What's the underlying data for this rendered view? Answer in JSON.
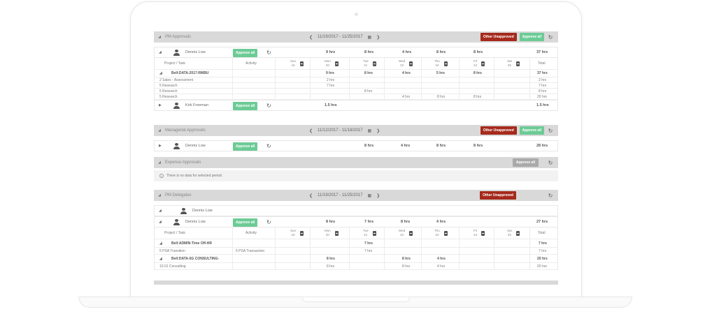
{
  "pm_approvals": {
    "title": "PM Approvals",
    "date_range": "11/19/2017 - 11/25/2017",
    "other_unapproved": "Other Unapproved",
    "approve_all": "Approve all",
    "person1": {
      "name": "Dennis Low",
      "approve_all": "Approve all",
      "hours": [
        "9 hrs",
        "8 hrs",
        "4 hrs",
        "8 hrs",
        "8 hrs"
      ],
      "total": "37 hrs"
    },
    "header": {
      "project_task": "Project / Task",
      "activity": "Activity",
      "days": [
        {
          "name": "Sun",
          "num": "19"
        },
        {
          "name": "Mon",
          "num": "20"
        },
        {
          "name": "Tue",
          "num": "21"
        },
        {
          "name": "Wed",
          "num": "22"
        },
        {
          "name": "Thu",
          "num": "23"
        },
        {
          "name": "Fri",
          "num": "24"
        },
        {
          "name": "Sat",
          "num": "25"
        }
      ],
      "total": "Total"
    },
    "project": {
      "name": "Bell:DATA-2017-RMBU",
      "hours": [
        "9 hrs",
        "8 hrs",
        "4 hrs",
        "5 hrs",
        "8 hrs"
      ],
      "total": "37 hrs"
    },
    "tasks": [
      {
        "name": "2 Sales - Assessment",
        "mon": "2 hrs",
        "tue": "",
        "wed": "",
        "thu": "",
        "fri": "",
        "total": "2 hrs"
      },
      {
        "name": "5 Research",
        "mon": "7 hrs",
        "tue": "",
        "wed": "",
        "thu": "",
        "fri": "",
        "total": "7 hrs"
      },
      {
        "name": "5 Research",
        "mon": "",
        "tue": "8 hrs",
        "wed": "",
        "thu": "",
        "fri": "",
        "total": "8 hrs"
      },
      {
        "name": "5 Research",
        "mon": "",
        "tue": "",
        "wed": "4 hrs",
        "thu": "8 hrs",
        "fri": "8 hrs",
        "total": "20 hrs"
      }
    ],
    "person2": {
      "name": "Kirk Freeman",
      "approve_all": "Approve all",
      "hours": "1.5 hrs",
      "total": "1.5 hrs"
    }
  },
  "managerial_approvals": {
    "title": "Managerial Approvals",
    "date_range": "11/12/2017 - 11/18/2017",
    "other_unapproved": "Other Unapproved",
    "approve_all": "Approve all",
    "person1": {
      "name": "Dennis Low",
      "approve_all": "Approve all",
      "hours": [
        "8 hrs",
        "4 hrs",
        "8 hrs",
        "8 hrs"
      ],
      "total": "28 hrs"
    }
  },
  "expense_approvals": {
    "title": "Expense Approvals",
    "approve_all": "Approve all",
    "no_data": "There is no data for selected period."
  },
  "pm_delegates": {
    "title": "PM Delegates",
    "date_range": "11/19/2017 - 11/25/2017",
    "other_unapproved": "Other Unapproved",
    "delegate_name": "Dennis Low",
    "person1": {
      "name": "Dennis Low",
      "approve_all": "Approve all",
      "hours": [
        "8 hrs",
        "7 hrs",
        "8 hrs",
        "4 hrs"
      ],
      "total": "27 hrs"
    },
    "header": {
      "project_task": "Project / Task",
      "activity": "Activity",
      "days": [
        {
          "name": "Sun",
          "num": "19"
        },
        {
          "name": "Mon",
          "num": "20"
        },
        {
          "name": "Tue",
          "num": "21"
        },
        {
          "name": "Wed",
          "num": "22"
        },
        {
          "name": "Thu",
          "num": "23"
        },
        {
          "name": "Fri",
          "num": "24"
        },
        {
          "name": "Sat",
          "num": "25"
        }
      ],
      "total": "Total"
    },
    "project1": {
      "name": "Bell:ADMIN-Time Off-HR",
      "tue": "7 hrs",
      "total": "7 hrs"
    },
    "task1": {
      "name": "5 PSA Transition",
      "activity": "5 PSA Transaction",
      "tue": "7 hrs",
      "total": "7 hrs"
    },
    "project2": {
      "name": "Bell:DATA-5G CONSULTING-",
      "mon": "8 hrs",
      "wed": "8 hrs",
      "thu": "4 hrs",
      "total": "20 hrs"
    },
    "task2": {
      "name": "10.01 Consulting",
      "mon": "8 hrs",
      "wed": "8 hrs",
      "thu": "4 hrs",
      "total": "20 hrs"
    }
  }
}
